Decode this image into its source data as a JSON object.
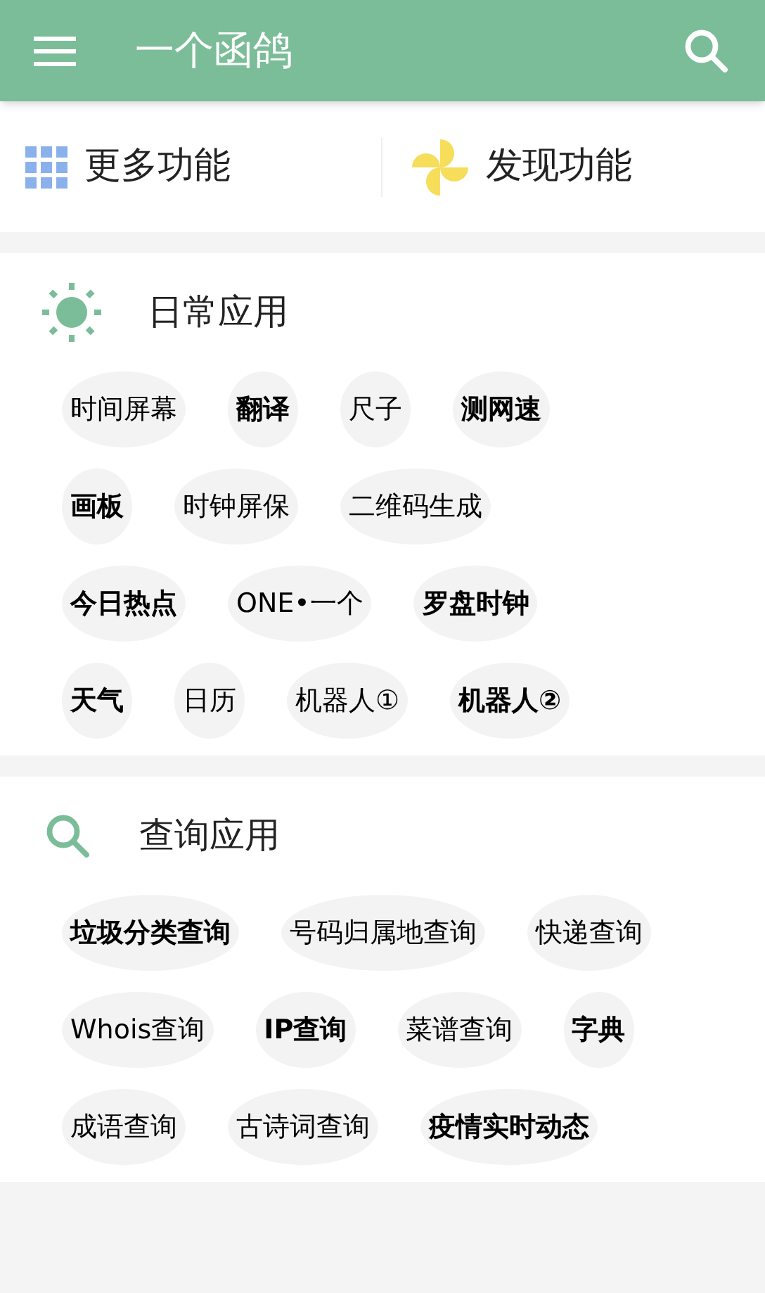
{
  "app_bar": {
    "title": "一个函鸽"
  },
  "quick_actions": [
    {
      "label": "更多功能",
      "kind": "grid"
    },
    {
      "label": "发现功能",
      "kind": "pinwheel"
    }
  ],
  "sections": [
    {
      "title": "日常应用",
      "kind": "sun",
      "rows": [
        [
          {
            "label": "时间屏幕",
            "bold": false
          },
          {
            "label": "翻译",
            "bold": true
          },
          {
            "label": "尺子",
            "bold": false
          },
          {
            "label": "测网速",
            "bold": true
          }
        ],
        [
          {
            "label": "画板",
            "bold": true
          },
          {
            "label": "时钟屏保",
            "bold": false
          },
          {
            "label": "二维码生成",
            "bold": false
          }
        ],
        [
          {
            "label": "今日热点",
            "bold": true
          },
          {
            "label": "ONE•一个",
            "bold": false
          },
          {
            "label": "罗盘时钟",
            "bold": true
          }
        ],
        [
          {
            "label": "天气",
            "bold": true
          },
          {
            "label": "日历",
            "bold": false
          },
          {
            "label": "机器人①",
            "bold": false
          },
          {
            "label": "机器人②",
            "bold": true
          }
        ]
      ]
    },
    {
      "title": "查询应用",
      "kind": "search",
      "rows": [
        [
          {
            "label": "垃圾分类查询",
            "bold": true
          },
          {
            "label": "号码归属地查询",
            "bold": false
          },
          {
            "label": "快递查询",
            "bold": false
          }
        ],
        [
          {
            "label": "Whois查询",
            "bold": false
          },
          {
            "label": "IP查询",
            "bold": true
          },
          {
            "label": "菜谱查询",
            "bold": false
          },
          {
            "label": "字典",
            "bold": true
          }
        ],
        [
          {
            "label": "成语查询",
            "bold": false
          },
          {
            "label": "古诗词查询",
            "bold": false
          },
          {
            "label": "疫情实时动态",
            "bold": true
          }
        ]
      ]
    }
  ]
}
